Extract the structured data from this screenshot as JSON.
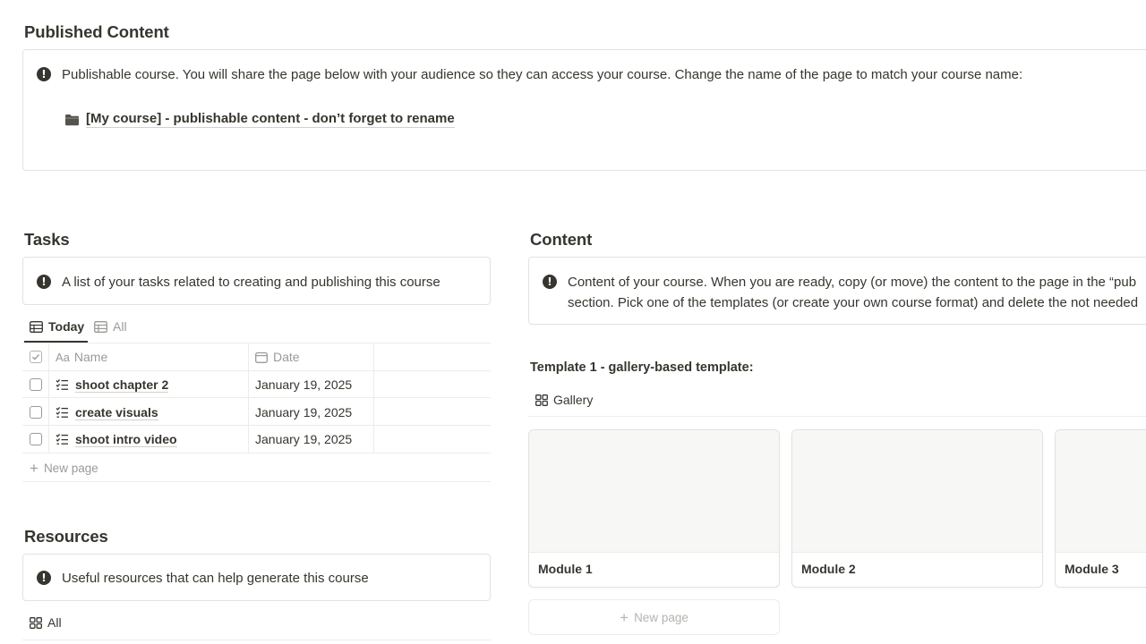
{
  "published": {
    "heading": "Published Content",
    "callout_text": "Publishable course. You will share the page below with your audience so they can access your course. Change the name of the page to match your course name:",
    "page_link": "[My course] - publishable content - don’t forget to rename"
  },
  "tasks": {
    "heading": "Tasks",
    "callout_text": "A list of your tasks related to creating and publishing this course",
    "tabs": [
      {
        "label": "Today",
        "active": true
      },
      {
        "label": "All",
        "active": false
      }
    ],
    "columns": {
      "name_prefix": "Aa",
      "name": "Name",
      "date": "Date"
    },
    "rows": [
      {
        "name": "shoot chapter 2",
        "date": "January 19, 2025"
      },
      {
        "name": "create visuals",
        "date": "January 19, 2025"
      },
      {
        "name": "shoot intro video",
        "date": "January 19, 2025"
      }
    ],
    "new_page": "New page"
  },
  "resources": {
    "heading": "Resources",
    "callout_text": "Useful resources that can help generate this course",
    "tab_label": "All"
  },
  "content": {
    "heading": "Content",
    "callout_line1": "Content of your course. When you are ready, copy (or move) the content to the page in the “pub",
    "callout_line2": "section. Pick one of the templates (or create your own course format) and delete the not needed",
    "template_title": "Template 1 - gallery-based template:",
    "view_label": "Gallery",
    "cards": [
      {
        "title": "Module 1"
      },
      {
        "title": "Module 2"
      },
      {
        "title": "Module 3"
      }
    ],
    "new_page": "New page"
  },
  "icons": {
    "callout": "exclamation-circle-icon",
    "folder": "folder-icon",
    "table_view": "table-icon",
    "gallery_view": "gallery-icon",
    "checklist": "checklist-icon",
    "calendar": "calendar-icon",
    "plus": "plus-icon"
  },
  "colors": {
    "text": "#37352f",
    "muted": "#9b9a97",
    "border": "#e3e2e0",
    "cover": "#f7f7f5"
  }
}
